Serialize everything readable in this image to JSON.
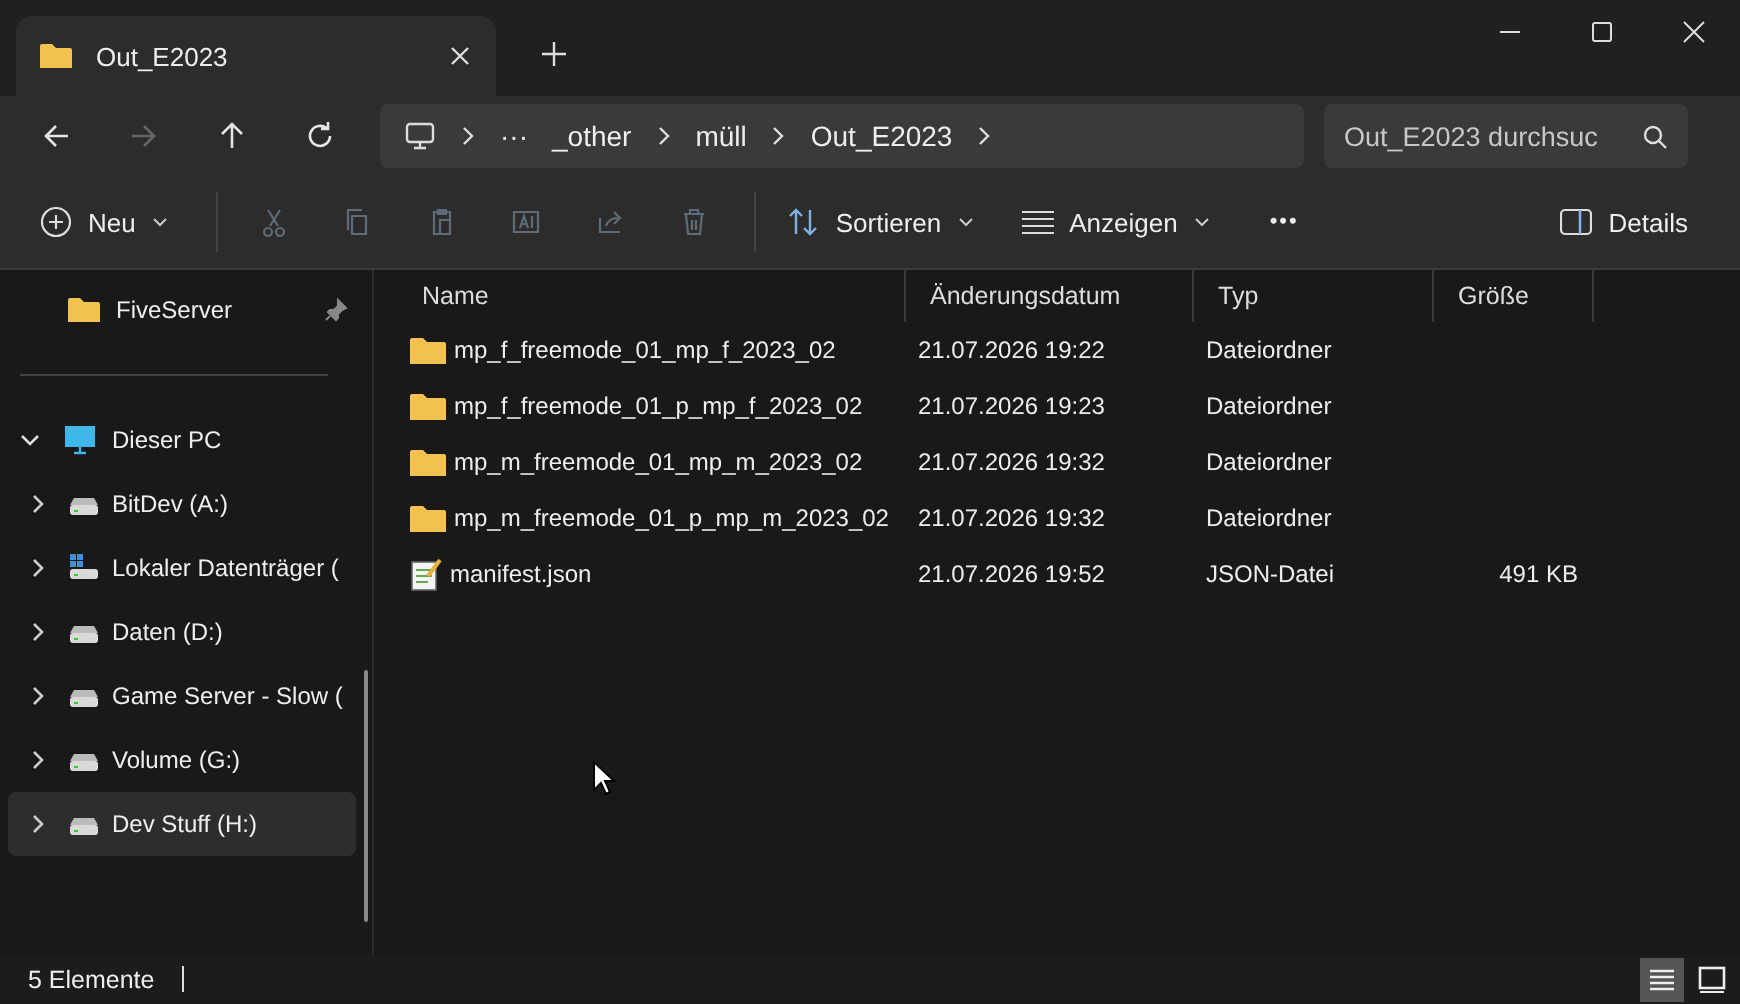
{
  "tab": {
    "title": "Out_E2023",
    "selected": true
  },
  "nav": [
    {
      "disabled": false
    },
    {
      "disabled": true
    },
    {
      "disabled": false
    },
    {
      "disabled": false
    }
  ],
  "breadcrumb": {
    "overflow": "···",
    "items": [
      "_other",
      "müll",
      "Out_E2023"
    ]
  },
  "search": {
    "placeholder": "Out_E2023 durchsuc"
  },
  "toolbar": {
    "new": "Neu",
    "actions": [
      {
        "disabled": true
      },
      {
        "disabled": true
      },
      {
        "disabled": true
      },
      {
        "disabled": true
      },
      {
        "disabled": true
      },
      {
        "disabled": true
      }
    ],
    "sort": "Sortieren",
    "view": "Anzeigen",
    "more": "•••",
    "details": "Details"
  },
  "sidebar": {
    "pinned": [
      {
        "label": "FiveServer",
        "pinned": true
      }
    ],
    "this_pc": {
      "label": "Dieser PC",
      "expanded": true,
      "children": [
        {
          "label": "BitDev (A:)",
          "kind": "drive",
          "selected": false
        },
        {
          "label": "Lokaler Datenträger (",
          "kind": "system",
          "selected": false
        },
        {
          "label": "Daten (D:)",
          "kind": "drive",
          "selected": false
        },
        {
          "label": "Game Server - Slow (",
          "kind": "drive",
          "selected": false
        },
        {
          "label": "Volume (G:)",
          "kind": "drive",
          "selected": false
        },
        {
          "label": "Dev Stuff (H:)",
          "kind": "drive",
          "selected": true
        }
      ]
    }
  },
  "table": {
    "columns": [
      "Name",
      "Änderungsdatum",
      "Typ",
      "Größe"
    ],
    "rows": [
      {
        "kind": "folder",
        "name": "mp_f_freemode_01_mp_f_2023_02",
        "date": "21.07.2026 19:22",
        "type": "Dateiordner"
      },
      {
        "kind": "folder",
        "name": "mp_f_freemode_01_p_mp_f_2023_02",
        "date": "21.07.2026 19:23",
        "type": "Dateiordner"
      },
      {
        "kind": "folder",
        "name": "mp_m_freemode_01_mp_m_2023_02",
        "date": "21.07.2026 19:32",
        "type": "Dateiordner"
      },
      {
        "kind": "folder",
        "name": "mp_m_freemode_01_p_mp_m_2023_02",
        "date": "21.07.2026 19:32",
        "type": "Dateiordner"
      },
      {
        "kind": "file",
        "name": "manifest.json",
        "date": "21.07.2026 19:52",
        "type": "JSON-Datei",
        "size": "491 KB"
      }
    ]
  },
  "status": {
    "count": "5 Elemente",
    "views": [
      {
        "selected": true
      },
      {
        "selected": false
      }
    ]
  }
}
